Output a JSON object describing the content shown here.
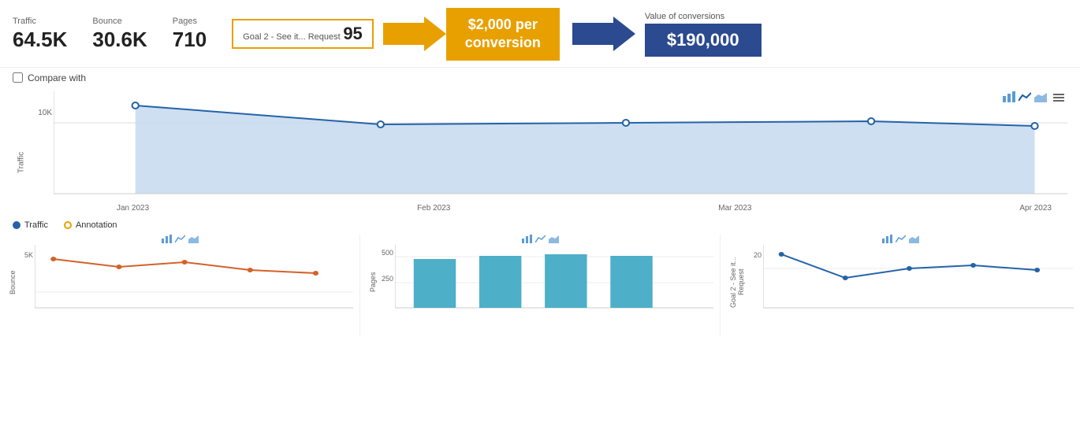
{
  "metrics": {
    "traffic": {
      "label": "Traffic",
      "value": "64.5K"
    },
    "bounce": {
      "label": "Bounce",
      "value": "30.6K"
    },
    "pages": {
      "label": "Pages",
      "value": "710"
    },
    "goal": {
      "label": "Goal 2 - See it... Request",
      "value": "95"
    },
    "conversion": {
      "text1": "$2,000 per",
      "text2": "conversion"
    },
    "value_of_conversions": {
      "label": "Value of conversions",
      "value": "$190,000"
    }
  },
  "compare": {
    "label": "Compare with"
  },
  "chart": {
    "y_label": "Traffic",
    "y_tick": "10K",
    "x_labels": [
      "Jan 2023",
      "Feb 2023",
      "Mar 2023",
      "Apr 2023"
    ]
  },
  "legend": {
    "items": [
      {
        "label": "Traffic",
        "color": "#2563a8"
      },
      {
        "label": "Annotation",
        "color": "#e8a000"
      }
    ]
  },
  "bottom_charts": {
    "icons": {
      "bar": "⬜",
      "line": "📈",
      "area": "🏔"
    }
  },
  "chart_icons": {
    "bar_label": "bar-chart",
    "line_label": "line-chart",
    "area_label": "area-chart",
    "menu_label": "menu"
  }
}
